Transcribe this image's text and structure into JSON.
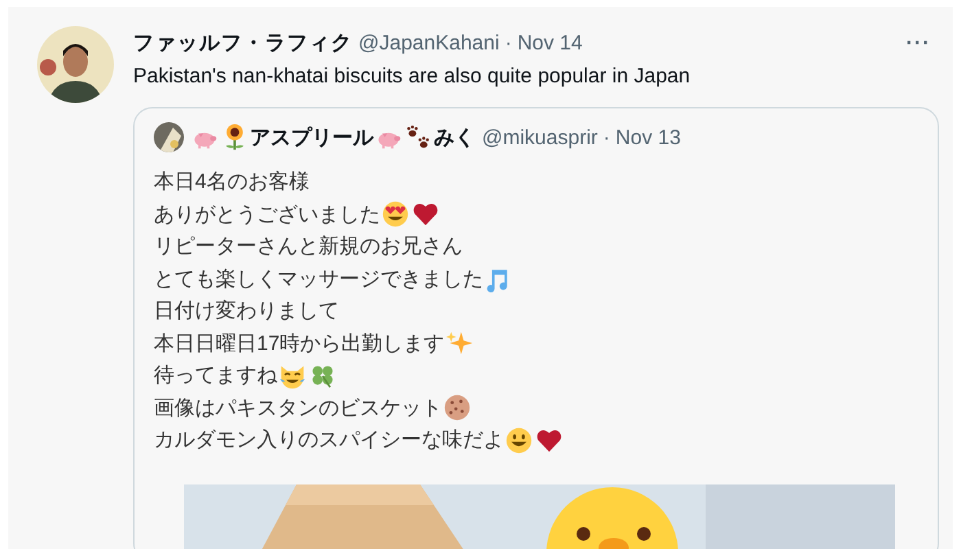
{
  "tweet": {
    "author_name": "ファッルフ・ラフィク",
    "handle": "@JapanKahani",
    "separator": "·",
    "date": "Nov 14",
    "more": "···",
    "text": "Pakistan's nan-khatai biscuits are also quite popular in Japan",
    "quote": {
      "name": [
        {
          "kind": "pig"
        },
        {
          "kind": "sunflower"
        },
        {
          "kind": "text",
          "text": "アスプリール"
        },
        {
          "kind": "pig"
        },
        {
          "kind": "paws"
        },
        {
          "kind": "text",
          "text": "みく"
        }
      ],
      "handle": "@mikuasprir",
      "separator": "·",
      "date": "Nov 13",
      "lines": [
        [
          {
            "kind": "text",
            "text": "本日4名のお客様"
          }
        ],
        [
          {
            "kind": "text",
            "text": "ありがとうございました"
          },
          {
            "kind": "hearteyes"
          },
          {
            "kind": "heart"
          }
        ],
        [
          {
            "kind": "text",
            "text": "リピーターさんと新規のお兄さん"
          }
        ],
        [
          {
            "kind": "text",
            "text": "とても楽しくマッサージできました"
          },
          {
            "kind": "notes"
          }
        ],
        [
          {
            "kind": "text",
            "text": "日付け変わりまして"
          }
        ],
        [
          {
            "kind": "text",
            "text": "本日日曜日17時から出勤します"
          },
          {
            "kind": "sparkles"
          }
        ],
        [
          {
            "kind": "text",
            "text": "待ってますね"
          },
          {
            "kind": "joycat"
          },
          {
            "kind": "clover"
          }
        ],
        [
          {
            "kind": "text",
            "text": "画像はパキスタンのビスケット"
          },
          {
            "kind": "cookie"
          }
        ],
        [
          {
            "kind": "text",
            "text": "カルダモン入りのスパイシーな味だよ"
          },
          {
            "kind": "smiley"
          },
          {
            "kind": "heart"
          }
        ]
      ],
      "media": {
        "kind": "picture"
      }
    }
  }
}
